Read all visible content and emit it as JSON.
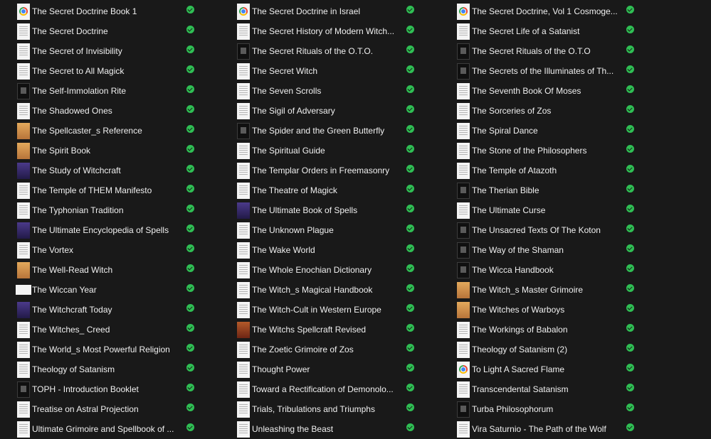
{
  "status_icon": "sync-complete-check-icon",
  "status_color": "#2fbf54",
  "columns": [
    [
      {
        "label": "The Secret Doctrine Book 1",
        "icon": "chrome"
      },
      {
        "label": "The Secret Doctrine",
        "icon": "doc"
      },
      {
        "label": "The Secret of Invisibility",
        "icon": "doc"
      },
      {
        "label": "The Secret to All Magick",
        "icon": "doc"
      },
      {
        "label": "The Self-Immolation Rite",
        "icon": "dark"
      },
      {
        "label": "The Shadowed Ones",
        "icon": "doc"
      },
      {
        "label": "The Spellcaster_s Reference",
        "icon": "tan"
      },
      {
        "label": "The Spirit Book",
        "icon": "tan"
      },
      {
        "label": "The Study of Witchcraft",
        "icon": "purple"
      },
      {
        "label": "The Temple of THEM Manifesto",
        "icon": "doc"
      },
      {
        "label": "The Typhonian Tradition",
        "icon": "doc"
      },
      {
        "label": "The Ultimate Encyclopedia of Spells",
        "icon": "purple"
      },
      {
        "label": "The Vortex",
        "icon": "doc"
      },
      {
        "label": "The Well-Read Witch",
        "icon": "tan"
      },
      {
        "label": "The Wiccan Year",
        "icon": "wide"
      },
      {
        "label": "The Witchcraft Today",
        "icon": "purple"
      },
      {
        "label": "The Witches_ Creed",
        "icon": "doc"
      },
      {
        "label": "The World_s Most Powerful Religion",
        "icon": "doc"
      },
      {
        "label": "Theology of Satanism",
        "icon": "doc"
      },
      {
        "label": "TOPH - Introduction Booklet",
        "icon": "dark"
      },
      {
        "label": "Treatise on Astral Projection",
        "icon": "doc"
      },
      {
        "label": "Ultimate Grimoire and Spellbook of ...",
        "icon": "doc"
      }
    ],
    [
      {
        "label": "The Secret Doctrine in Israel",
        "icon": "chrome"
      },
      {
        "label": "The Secret History of Modern Witch...",
        "icon": "doc"
      },
      {
        "label": "The Secret Rituals of the O.T.O.",
        "icon": "dark"
      },
      {
        "label": "The Secret Witch",
        "icon": "doc"
      },
      {
        "label": "The Seven Scrolls",
        "icon": "doc"
      },
      {
        "label": "The Sigil of Adversary",
        "icon": "doc"
      },
      {
        "label": "The Spider and the Green Butterfly",
        "icon": "dark"
      },
      {
        "label": "The Spiritual Guide",
        "icon": "doc"
      },
      {
        "label": "The Templar Orders in Freemasonry",
        "icon": "doc"
      },
      {
        "label": "The Theatre of Magick",
        "icon": "doc"
      },
      {
        "label": "The Ultimate Book of Spells",
        "icon": "purple"
      },
      {
        "label": "The Unknown Plague",
        "icon": "doc"
      },
      {
        "label": "The Wake World",
        "icon": "doc"
      },
      {
        "label": "The Whole Enochian Dictionary",
        "icon": "doc"
      },
      {
        "label": "The Witch_s Magical Handbook",
        "icon": "doc"
      },
      {
        "label": "The Witch-Cult in Western Europe",
        "icon": "doc"
      },
      {
        "label": "The Witchs Spellcraft Revised",
        "icon": "red"
      },
      {
        "label": "The Zoetic Grimoire of Zos",
        "icon": "doc"
      },
      {
        "label": "Thought Power",
        "icon": "doc"
      },
      {
        "label": "Toward a Rectification of Demonolo...",
        "icon": "doc"
      },
      {
        "label": "Trials, Tribulations and Triumphs",
        "icon": "doc"
      },
      {
        "label": "Unleashing the Beast",
        "icon": "doc"
      }
    ],
    [
      {
        "label": "The Secret Doctrine, Vol 1 Cosmoge...",
        "icon": "chrome"
      },
      {
        "label": "The Secret Life of a Satanist",
        "icon": "doc"
      },
      {
        "label": "The Secret Rituals of the O.T.O",
        "icon": "dark"
      },
      {
        "label": "The Secrets of the Illuminates of Th...",
        "icon": "dark"
      },
      {
        "label": "The Seventh Book Of Moses",
        "icon": "doc"
      },
      {
        "label": "The Sorceries of Zos",
        "icon": "doc"
      },
      {
        "label": "The Spiral Dance",
        "icon": "doc"
      },
      {
        "label": "The Stone of the Philosophers",
        "icon": "doc"
      },
      {
        "label": "The Temple of Atazoth",
        "icon": "doc"
      },
      {
        "label": "The Therian Bible",
        "icon": "dark"
      },
      {
        "label": "The Ultimate Curse",
        "icon": "doc"
      },
      {
        "label": "The Unsacred Texts Of The Koton",
        "icon": "dark"
      },
      {
        "label": "The Way of the Shaman",
        "icon": "dark"
      },
      {
        "label": "The Wicca Handbook",
        "icon": "dark"
      },
      {
        "label": "The Witch_s Master Grimoire",
        "icon": "tan"
      },
      {
        "label": "The Witches of Warboys",
        "icon": "tan"
      },
      {
        "label": "The Workings of Babalon",
        "icon": "doc"
      },
      {
        "label": "Theology of Satanism (2)",
        "icon": "doc"
      },
      {
        "label": "To Light A Sacred Flame",
        "icon": "chrome"
      },
      {
        "label": "Transcendental Satanism",
        "icon": "doc"
      },
      {
        "label": "Turba Philosophorum",
        "icon": "dark"
      },
      {
        "label": "Vira Saturnio - The Path of the Wolf",
        "icon": "doc"
      }
    ]
  ]
}
